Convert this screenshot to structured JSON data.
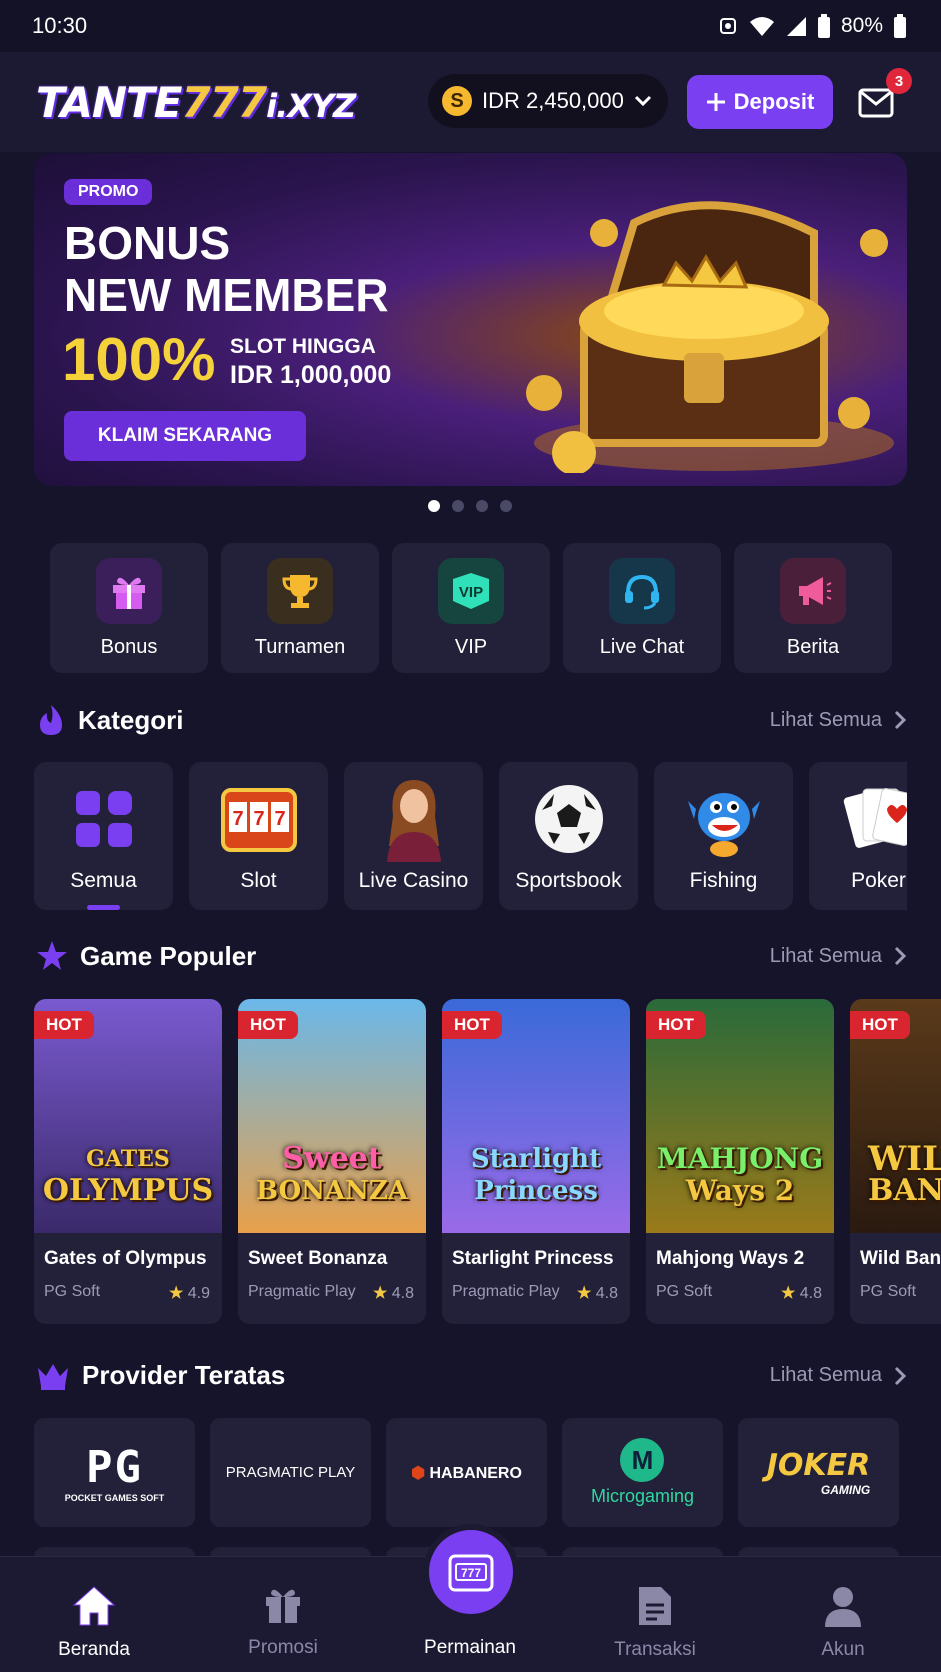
{
  "status": {
    "time": "10:30",
    "battery": "80%"
  },
  "header": {
    "logo_main": "TANTE",
    "logo_num": "777",
    "logo_suffix": "i.XYZ",
    "balance": "IDR 2,450,000",
    "coin_symbol": "S",
    "deposit_label": "Deposit",
    "mail_count": "3"
  },
  "banner": {
    "tag": "PROMO",
    "title_line1": "BONUS",
    "title_line2": "NEW MEMBER",
    "percent": "100%",
    "detail_line1": "SLOT HINGGA",
    "detail_line2": "IDR 1,000,000",
    "cta": "KLAIM SEKARANG",
    "slides": 4,
    "active_slide": 1
  },
  "quick_menu": [
    {
      "label": "Bonus",
      "icon": "gift-icon",
      "bg": "#3a1f5a",
      "fg": "#d65bf0"
    },
    {
      "label": "Turnamen",
      "icon": "trophy-icon",
      "bg": "#3a2f1f",
      "fg": "#f5b82e"
    },
    {
      "label": "VIP",
      "icon": "vip-badge-icon",
      "bg": "#16443e",
      "fg": "#2fe0b8"
    },
    {
      "label": "Live Chat",
      "icon": "headset-icon",
      "bg": "#16364a",
      "fg": "#2fb6f0"
    },
    {
      "label": "Berita",
      "icon": "megaphone-icon",
      "bg": "#4a1f3a",
      "fg": "#f05b9c"
    }
  ],
  "kategori": {
    "title": "Kategori",
    "see_all": "Lihat Semua",
    "items": [
      {
        "label": "Semua",
        "icon": "grid-icon"
      },
      {
        "label": "Slot",
        "icon": "slot-machine-icon"
      },
      {
        "label": "Live Casino",
        "icon": "dealer-icon"
      },
      {
        "label": "Sportsbook",
        "icon": "soccer-ball-icon"
      },
      {
        "label": "Fishing",
        "icon": "fish-icon"
      },
      {
        "label": "Poker",
        "icon": "cards-icon"
      }
    ]
  },
  "popular": {
    "title": "Game Populer",
    "see_all": "Lihat Semua",
    "hot_label": "HOT",
    "games": [
      {
        "name": "Gates of Olympus",
        "provider": "PG Soft",
        "rating": "4.9",
        "art1": "GATES",
        "art2": "OLYMPUS",
        "bg1": "#6a4ab8",
        "bg2": "#3a2a6a",
        "color": "#f5c842"
      },
      {
        "name": "Sweet Bonanza",
        "provider": "Pragmatic Play",
        "rating": "4.8",
        "art1": "Sweet",
        "art2": "BONANZA",
        "bg1": "#5fb4e8",
        "bg2": "#e89a4a",
        "color": "#ff5fa8"
      },
      {
        "name": "Starlight Princess",
        "provider": "Pragmatic Play",
        "rating": "4.8",
        "art1": "Starlight",
        "art2": "Princess",
        "bg1": "#3a6ad8",
        "bg2": "#8a5ae0",
        "color": "#8ad8ff"
      },
      {
        "name": "Mahjong Ways 2",
        "provider": "PG Soft",
        "rating": "4.8",
        "art1": "MAHJONG",
        "art2": "Ways 2",
        "bg1": "#2a6a3a",
        "bg2": "#8a6a1a",
        "color": "#7af06a"
      },
      {
        "name": "Wild Bandito",
        "provider": "PG Soft",
        "rating": "",
        "art1": "WILD",
        "art2": "BAND",
        "bg1": "#4a2a1a",
        "bg2": "#2a1a10",
        "color": "#f5c842"
      }
    ]
  },
  "providers": {
    "title": "Provider Teratas",
    "see_all": "Lihat Semua",
    "items": [
      {
        "name": "PG",
        "sub": "POCKET GAMES SOFT"
      },
      {
        "name": "PRAGMATIC PLAY",
        "sub": ""
      },
      {
        "name": "HABANERO",
        "sub": ""
      },
      {
        "name": "Microgaming",
        "sub": ""
      },
      {
        "name": "JOKER",
        "sub": "GAMING"
      }
    ]
  },
  "nav": [
    {
      "label": "Beranda",
      "icon": "home-icon",
      "active": true
    },
    {
      "label": "Promosi",
      "icon": "gift-icon",
      "active": false
    },
    {
      "label": "Permainan",
      "icon": "slot-machine-icon",
      "active": false
    },
    {
      "label": "Transaksi",
      "icon": "document-icon",
      "active": false
    },
    {
      "label": "Akun",
      "icon": "user-icon",
      "active": false
    }
  ]
}
